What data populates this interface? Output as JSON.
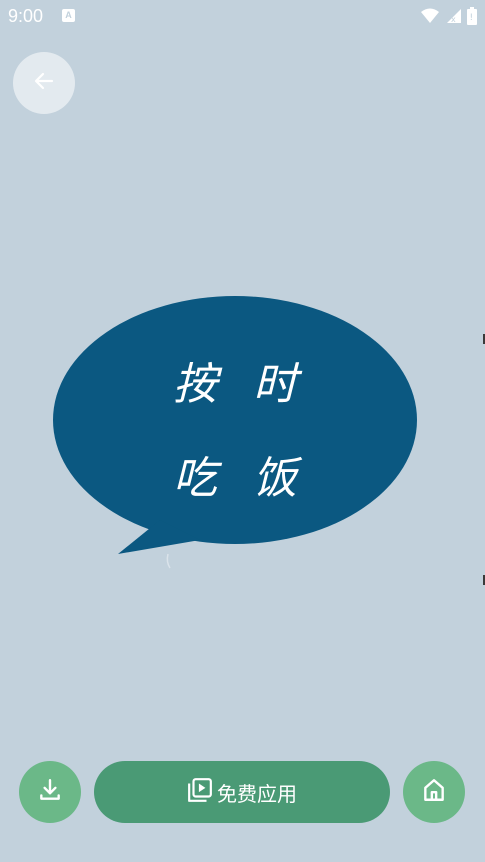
{
  "status_bar": {
    "time": "9:00",
    "notification_icon": "a-notification-icon",
    "icons": [
      "wifi-icon",
      "signal-icon",
      "battery-icon"
    ]
  },
  "header": {
    "back_icon": "arrow-left-icon"
  },
  "sticker": {
    "line1": "按时",
    "line2": "吃饭",
    "bubble_color": "#0b5881"
  },
  "actions": {
    "download_icon": "download-icon",
    "apply_label": "免费应用",
    "apply_icon": "video-library-icon",
    "home_icon": "home-icon"
  },
  "colors": {
    "background": "#c2d1dc",
    "accent": "#4a9a75",
    "accent_light": "#6bb888"
  }
}
